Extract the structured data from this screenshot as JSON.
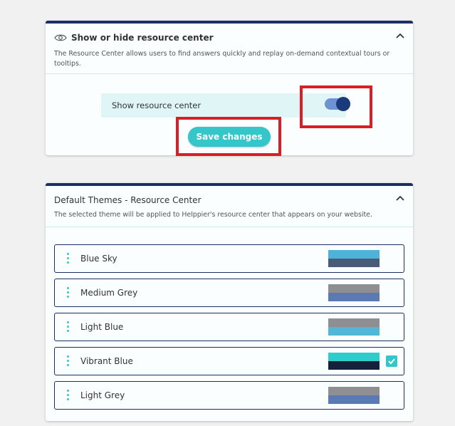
{
  "resource_center": {
    "title": "Show or hide resource center",
    "description": "The Resource Center allows users to find answers quickly and replay on-demand contextual tours or tooltips.",
    "toggle_label": "Show resource center",
    "toggle_on": true,
    "save_label": "Save changes"
  },
  "themes": {
    "title": "Default Themes - Resource Center",
    "description": "The selected theme will be applied to Helppier's resource center that appears on your website.",
    "items": [
      {
        "name": "Blue Sky",
        "top_color": "#4fb3d9",
        "bottom_color": "#4a5a7a",
        "selected": false
      },
      {
        "name": "Medium Grey",
        "top_color": "#8e8e93",
        "bottom_color": "#5a79b5",
        "selected": false
      },
      {
        "name": "Light Blue",
        "top_color": "#8e8e93",
        "bottom_color": "#52b6d8",
        "selected": false
      },
      {
        "name": "Vibrant Blue",
        "top_color": "#2ecccc",
        "bottom_color": "#14213d",
        "selected": true
      },
      {
        "name": "Light Grey",
        "top_color": "#8e8e93",
        "bottom_color": "#5a79b5",
        "selected": false
      }
    ]
  },
  "colors": {
    "accent": "#34c6c9",
    "header_border": "#1b2f66",
    "highlight": "#dc1d24"
  }
}
